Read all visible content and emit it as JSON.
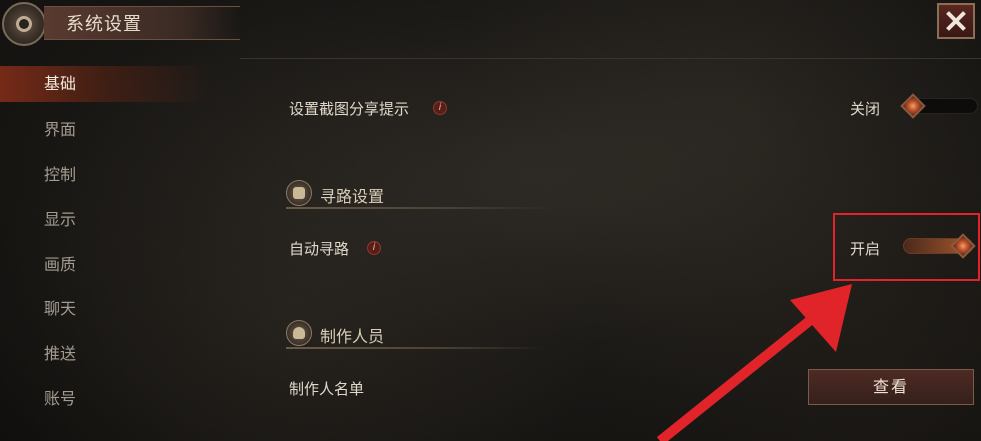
{
  "header": {
    "title": "系统设置"
  },
  "sidebar": {
    "items": [
      {
        "label": "基础",
        "active": true
      },
      {
        "label": "界面",
        "active": false
      },
      {
        "label": "控制",
        "active": false
      },
      {
        "label": "显示",
        "active": false
      },
      {
        "label": "画质",
        "active": false
      },
      {
        "label": "聊天",
        "active": false
      },
      {
        "label": "推送",
        "active": false
      },
      {
        "label": "账号",
        "active": false
      }
    ]
  },
  "settings": {
    "screenshot_share": {
      "label": "设置截图分享提示",
      "state_text": "关闭",
      "enabled": false
    },
    "pathfinding_section": {
      "title": "寻路设置"
    },
    "auto_pathfinding": {
      "label": "自动寻路",
      "state_text": "开启",
      "enabled": true
    },
    "credits_section": {
      "title": "制作人员"
    },
    "credits": {
      "label": "制作人名单",
      "button_label": "查看"
    }
  },
  "colors": {
    "accent": "#a4582a",
    "annotation": "#e0242a",
    "active_tab": "#96321a"
  }
}
